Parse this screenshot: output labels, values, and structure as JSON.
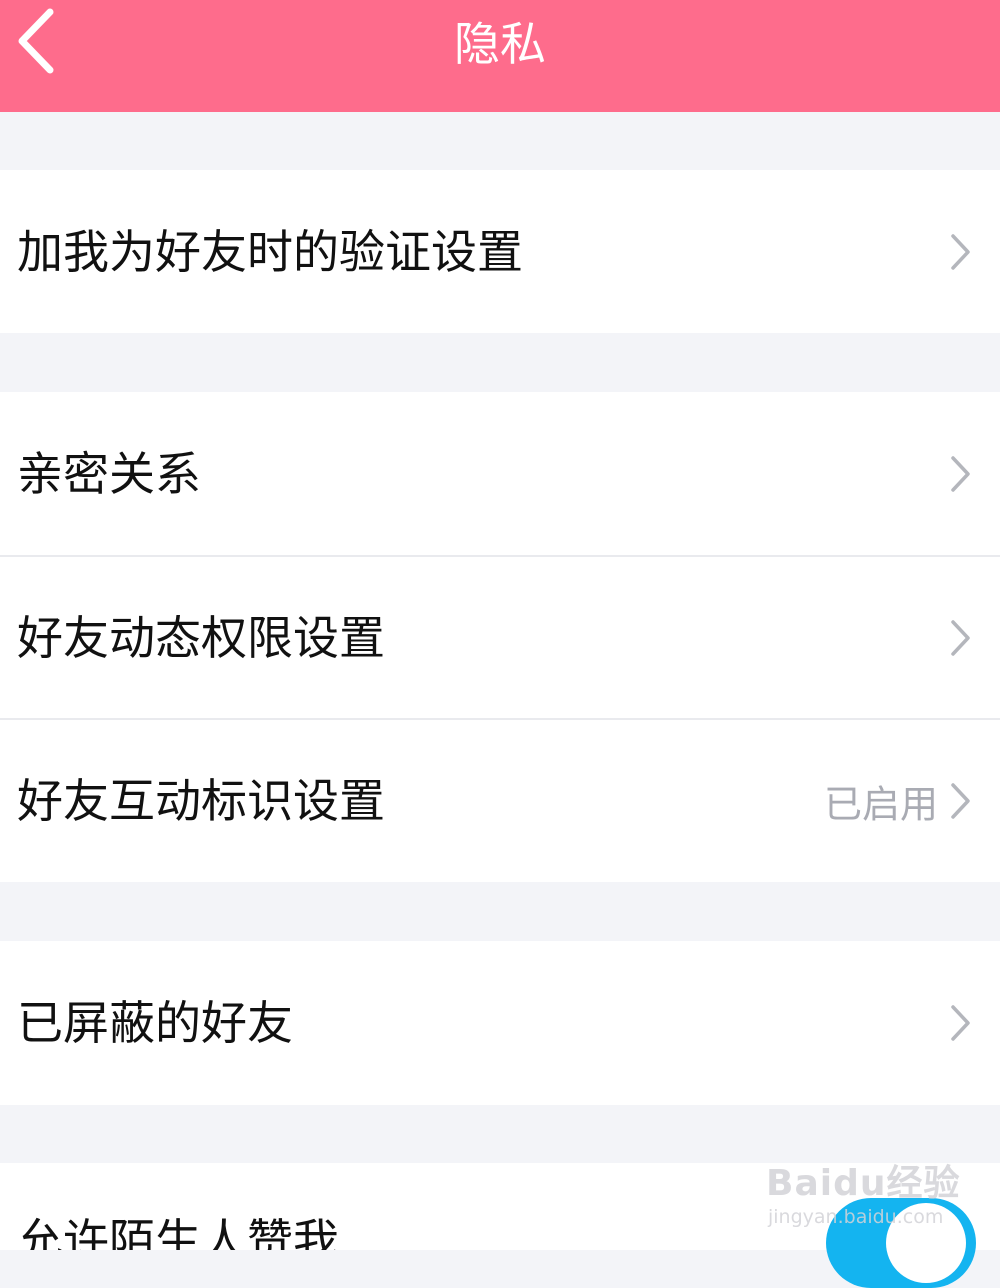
{
  "header": {
    "title": "隐私"
  },
  "rows": [
    {
      "label": "加我为好友时的验证设置"
    },
    {
      "label": "亲密关系"
    },
    {
      "label": "好友动态权限设置"
    },
    {
      "label": "好友互动标识设置",
      "status": "已启用"
    },
    {
      "label": "已屏蔽的好友"
    },
    {
      "label": "允许陌生人赞我",
      "toggle": true
    }
  ],
  "watermark": {
    "logo": "Baidu经验",
    "url": "jingyan.baidu.com"
  },
  "colors": {
    "header_bg": "#fe6c8c",
    "page_bg": "#f3f4f8",
    "toggle_on": "#14b4f0"
  },
  "icons": {
    "back": "chevron-left-icon",
    "row_arrow": "chevron-right-icon"
  }
}
